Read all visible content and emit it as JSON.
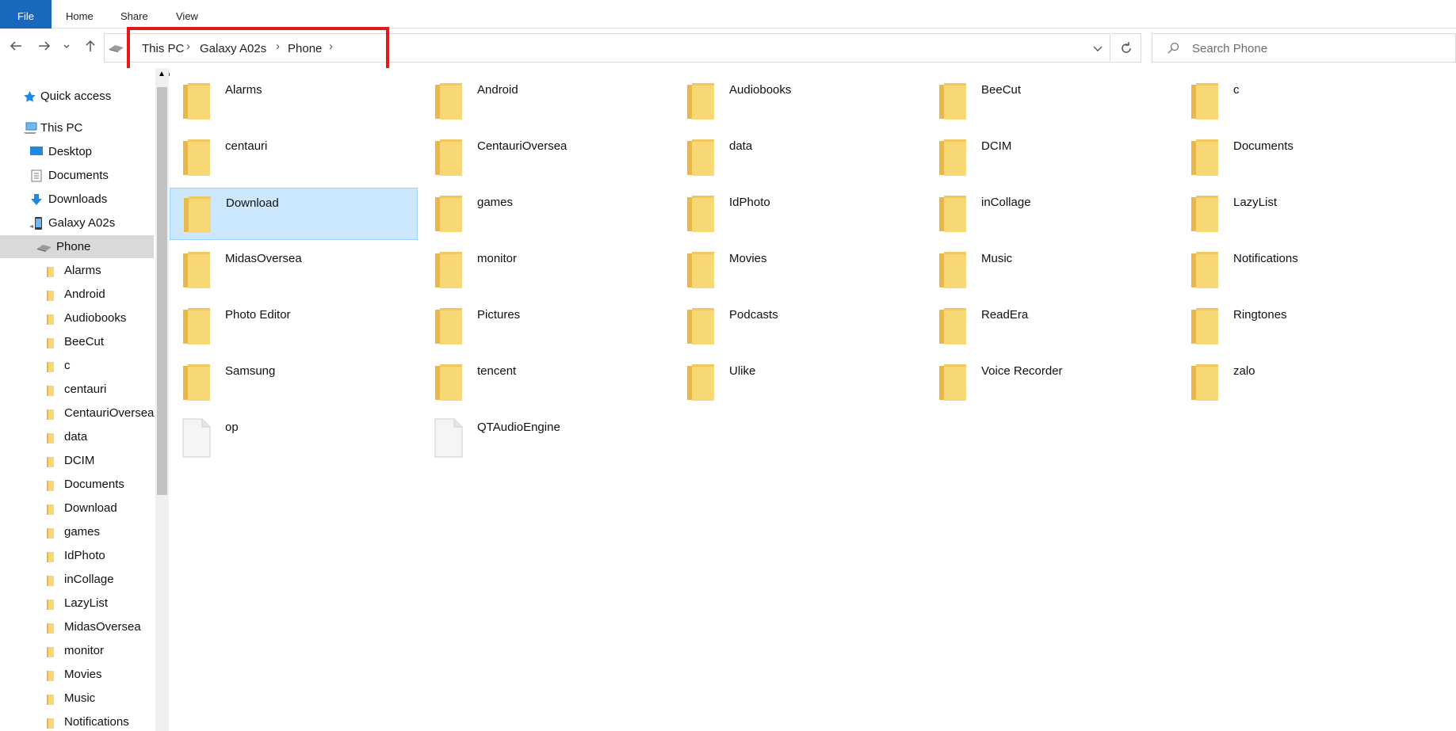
{
  "ribbon": {
    "file": "File",
    "home": "Home",
    "share": "Share",
    "view": "View"
  },
  "address": {
    "crumbs": [
      "This PC",
      "Galaxy A02s",
      "Phone"
    ]
  },
  "search": {
    "placeholder": "Search Phone"
  },
  "sidebar": {
    "quick_access": "Quick access",
    "this_pc": "This PC",
    "desktop": "Desktop",
    "documents": "Documents",
    "downloads": "Downloads",
    "device": "Galaxy A02s",
    "phone": "Phone",
    "folders": [
      "Alarms",
      "Android",
      "Audiobooks",
      "BeeCut",
      "c",
      "centauri",
      "CentauriOversea",
      "data",
      "DCIM",
      "Documents",
      "Download",
      "games",
      "IdPhoto",
      "inCollage",
      "LazyList",
      "MidasOversea",
      "monitor",
      "Movies",
      "Music",
      "Notifications"
    ]
  },
  "items": [
    {
      "name": "Alarms",
      "type": "folder"
    },
    {
      "name": "Android",
      "type": "folder"
    },
    {
      "name": "Audiobooks",
      "type": "folder"
    },
    {
      "name": "BeeCut",
      "type": "folder"
    },
    {
      "name": "c",
      "type": "folder"
    },
    {
      "name": "centauri",
      "type": "folder"
    },
    {
      "name": "CentauriOversea",
      "type": "folder"
    },
    {
      "name": "data",
      "type": "folder"
    },
    {
      "name": "DCIM",
      "type": "folder"
    },
    {
      "name": "Documents",
      "type": "folder"
    },
    {
      "name": "Download",
      "type": "folder",
      "selected": true
    },
    {
      "name": "games",
      "type": "folder"
    },
    {
      "name": "IdPhoto",
      "type": "folder"
    },
    {
      "name": "inCollage",
      "type": "folder"
    },
    {
      "name": "LazyList",
      "type": "folder"
    },
    {
      "name": "MidasOversea",
      "type": "folder"
    },
    {
      "name": "monitor",
      "type": "folder"
    },
    {
      "name": "Movies",
      "type": "folder"
    },
    {
      "name": "Music",
      "type": "folder"
    },
    {
      "name": "Notifications",
      "type": "folder"
    },
    {
      "name": "Photo Editor",
      "type": "folder"
    },
    {
      "name": "Pictures",
      "type": "folder"
    },
    {
      "name": "Podcasts",
      "type": "folder"
    },
    {
      "name": "ReadEra",
      "type": "folder"
    },
    {
      "name": "Ringtones",
      "type": "folder"
    },
    {
      "name": "Samsung",
      "type": "folder"
    },
    {
      "name": "tencent",
      "type": "folder"
    },
    {
      "name": "Ulike",
      "type": "folder"
    },
    {
      "name": "Voice Recorder",
      "type": "folder"
    },
    {
      "name": "zalo",
      "type": "folder"
    },
    {
      "name": "op",
      "type": "file"
    },
    {
      "name": "QTAudioEngine",
      "type": "file"
    }
  ],
  "colors": {
    "file_tab": "#1a68bd",
    "selection": "#cce8ff",
    "highlight_box": "#e01a1a",
    "folder": "#f8d775"
  }
}
